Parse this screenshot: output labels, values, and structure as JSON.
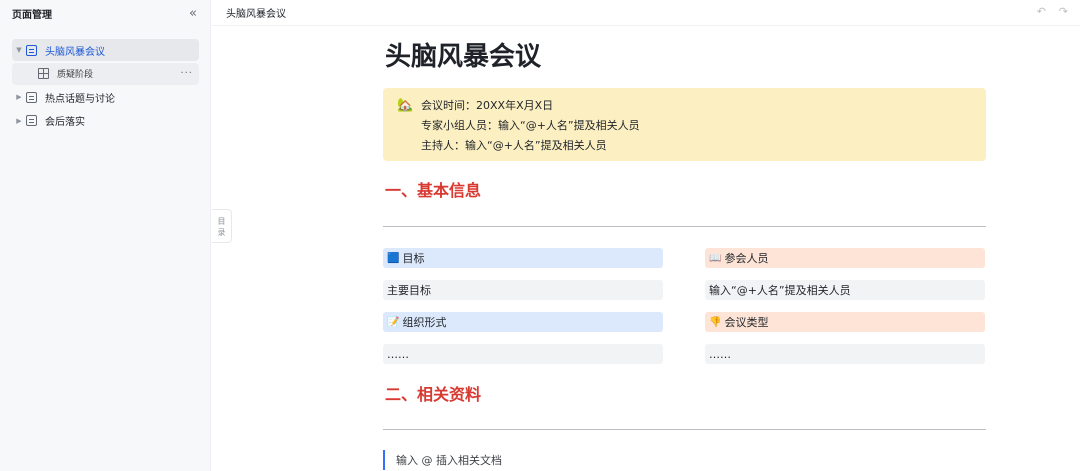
{
  "sidebar": {
    "title": "页面管理",
    "collapse_icon": "«",
    "items": [
      {
        "label": "头脑风暴会议",
        "active": true,
        "expanded": true
      },
      {
        "label": "质疑阶段",
        "type": "table",
        "more": "···"
      },
      {
        "label": "热点话题与讨论"
      },
      {
        "label": "会后落实"
      }
    ]
  },
  "topbar": {
    "title": "头脑风暴会议",
    "undo_icon": "↶",
    "redo_icon": "↷"
  },
  "toc": {
    "label_1": "目",
    "label_2": "录"
  },
  "doc": {
    "title": "头脑风暴会议",
    "callout": {
      "icon": "🏡",
      "lines": [
        "会议时间：20XX年X月X日",
        "专家小组人员：输入“@+人名”提及相关人员",
        "主持人：输入“@+人名”提及相关人员"
      ],
      "background": "#fcf0c2"
    },
    "section1": {
      "heading": "一、基本信息",
      "color": "#d83931"
    },
    "grid": {
      "goal_header": {
        "icon": "🟦",
        "label": "目标"
      },
      "attendees_header": {
        "icon": "📖",
        "label": "参会人员"
      },
      "goal_value": "主要目标",
      "attendees_value": "输入“@+人名”提及相关人员",
      "format_header": {
        "icon": "📝",
        "label": "组织形式"
      },
      "type_header": {
        "icon": "👎",
        "label": "会议类型"
      },
      "format_value": "……",
      "type_value": "……"
    },
    "section2": {
      "heading": "二、相关资料"
    },
    "quote_placeholder": "输入 @ 插入相关文档"
  }
}
